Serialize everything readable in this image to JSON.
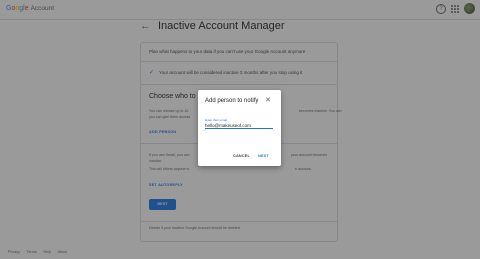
{
  "header": {
    "logo_google": [
      "G",
      "o",
      "o",
      "g",
      "l",
      "e"
    ],
    "logo_account": "Account",
    "help_icon": "help-icon",
    "apps_icon": "apps-icon",
    "avatar": "avatar"
  },
  "page": {
    "title": "Inactive Account Manager",
    "plan_text": "Plan what happens to your data if you can't use your Google Account anymore",
    "inactive_text": "Your account will be considered inactive 3 months after you stop using it",
    "choose_title": "Choose who to noti",
    "body_lines": [
      "You can choose up to 10",
      "you can give them access"
    ],
    "add_person_link": "ADD PERSON",
    "gmail_lines": [
      "If you use Gmail, you can",
      "inactive.",
      "This will inform anyone w"
    ],
    "gmail_lines_right": [
      "your account becomes",
      "e account."
    ],
    "right_line_1": "becomes inactive. You can",
    "set_autoreply_link": "SET AUTOREPLY",
    "next_button": "NEXT",
    "decide_text": "Decide if your inactive Google Account should be deleted"
  },
  "footer": {
    "links": [
      "Privacy",
      "Terms",
      "Help",
      "About"
    ]
  },
  "dialog": {
    "title": "Add person to notify",
    "field_label": "Enter their email",
    "email_value": "hello@makeuseof.com",
    "cancel": "CANCEL",
    "next": "NEXT"
  },
  "colors": {
    "accent": "#1a73e8",
    "scrim": "rgba(40,40,40,0.47)"
  }
}
